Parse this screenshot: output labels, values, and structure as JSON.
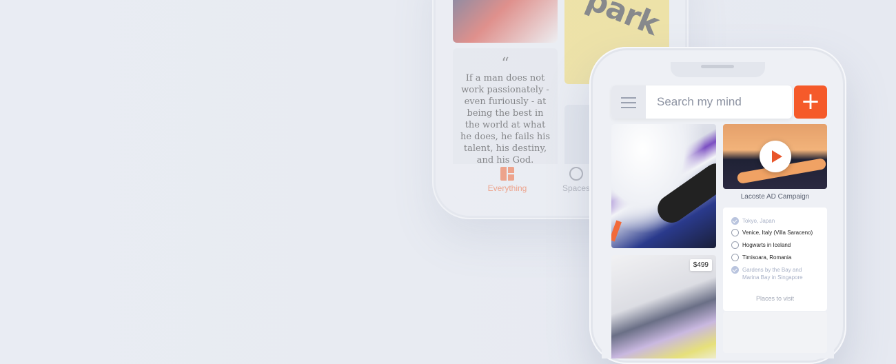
{
  "back_phone": {
    "quote": {
      "open": "“",
      "text": "If a man does not work passionately - even furiously - at being the best in the world at what he does, he fails his talent, his destiny, and his God.",
      "close": "”"
    },
    "nav": {
      "everything_label": "Everything",
      "spaces_label": "Spaces"
    },
    "park_text": "park"
  },
  "front_phone": {
    "search": {
      "placeholder": "Search my mind"
    },
    "add_label": "+",
    "video_caption": "Lacoste AD Campaign",
    "price": "$499",
    "places_list": {
      "items": [
        {
          "label": "Tokyo, Japan",
          "checked": true
        },
        {
          "label": "Venice, Italy (Villa Saraceno)",
          "checked": false
        },
        {
          "label": "Hogwarts in Iceland",
          "checked": false
        },
        {
          "label": "Timisoara, Romania",
          "checked": false
        },
        {
          "label": "Gardens by the Bay and Marina Bay in Singapore",
          "checked": true
        }
      ],
      "caption": "Places to visit"
    }
  },
  "colors": {
    "accent": "#f55a2a",
    "background": "#e8ebf2",
    "checked": "#b9c4de"
  }
}
